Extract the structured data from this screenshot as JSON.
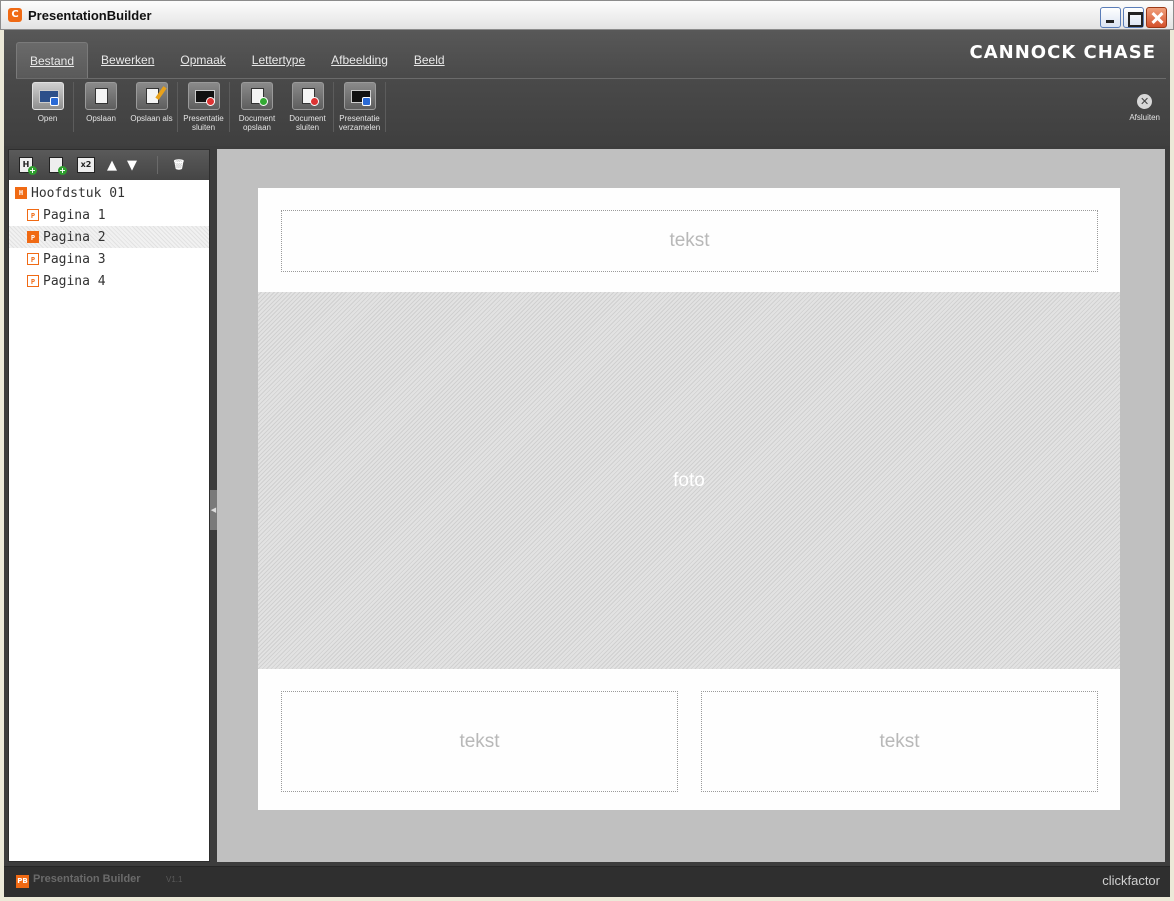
{
  "window": {
    "title": "PresentationBuilder",
    "app_icon": "app-logo-icon"
  },
  "header": {
    "tabs": [
      {
        "label": "Bestand",
        "active": true
      },
      {
        "label": "Bewerken",
        "active": false
      },
      {
        "label": "Opmaak",
        "active": false
      },
      {
        "label": "Lettertype",
        "active": false
      },
      {
        "label": "Afbeelding",
        "active": false
      },
      {
        "label": "Beeld",
        "active": false
      }
    ],
    "brand": "CANNOCK CHASE"
  },
  "toolbar": {
    "items": [
      {
        "label": "Open",
        "icon": "open-folder-icon"
      },
      {
        "label": "Opslaan",
        "icon": "save-icon"
      },
      {
        "label": "Opslaan als",
        "icon": "save-as-icon"
      },
      {
        "label": "Presentatie sluiten",
        "icon": "presentation-close-icon"
      },
      {
        "label": "Document opslaan",
        "icon": "document-save-icon"
      },
      {
        "label": "Document sluiten",
        "icon": "document-close-icon"
      },
      {
        "label": "Presentatie verzamelen",
        "icon": "presentation-collect-icon"
      }
    ],
    "exit_label": "Afsluiten"
  },
  "tree": {
    "tools": [
      "add-chapter-icon",
      "add-page-icon",
      "duplicate-icon",
      "move-up-icon",
      "move-down-icon",
      "delete-icon"
    ],
    "chapter": "Hoofdstuk 01",
    "pages": [
      "Pagina 1",
      "Pagina 2",
      "Pagina 3",
      "Pagina 4"
    ],
    "selected_page": "Pagina 2"
  },
  "slide": {
    "top_text": "tekst",
    "photo": "foto",
    "bottom_left_text": "tekst",
    "bottom_right_text": "tekst"
  },
  "footer": {
    "app_name": "Presentation Builder",
    "version": "V1.1",
    "credit": "clickfactor"
  },
  "colors": {
    "accent": "#f06a14",
    "frame": "#3d3d3d",
    "canvas": "#c0c0c0"
  }
}
